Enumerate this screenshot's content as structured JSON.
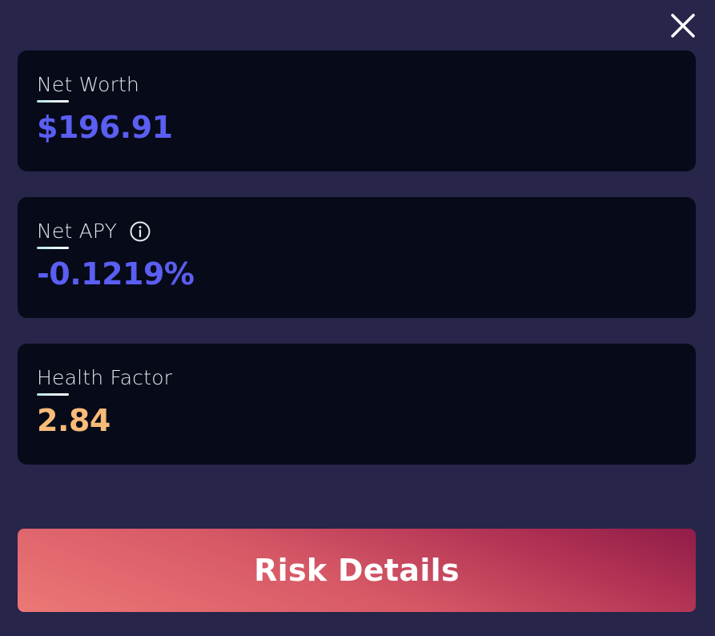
{
  "close_icon": "close-icon",
  "cards": [
    {
      "label": "Net Worth",
      "value": "$196.91",
      "value_color": "#5a5ef2"
    },
    {
      "label": "Net APY",
      "value": "-0.1219%",
      "value_color": "#5a5ef2",
      "icon": "info-icon"
    },
    {
      "label": "Health Factor",
      "value": "2.84",
      "value_color": "#f8bb78"
    }
  ],
  "risk_button": {
    "label": "Risk Details"
  },
  "colors": {
    "background": "#27254a",
    "card": "#070a18",
    "accent_blue": "#5a5ef2",
    "health_orange": "#f8bb78"
  }
}
